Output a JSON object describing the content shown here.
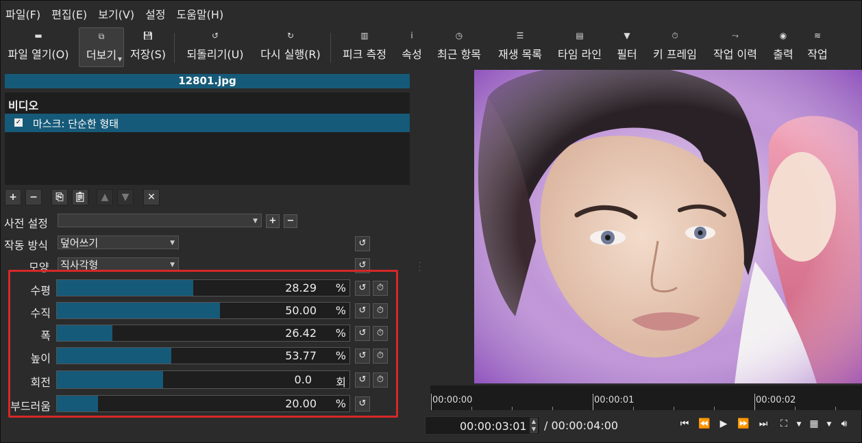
{
  "menu": [
    "파일(F)",
    "편집(E)",
    "보기(V)",
    "설정",
    "도움말(H)"
  ],
  "toolbar": {
    "open": "파일 열기(O)",
    "more": "더보기",
    "save": "저장(S)",
    "undo": "되돌리기(U)",
    "redo": "다시 실행(R)",
    "peak": "피크 측정",
    "properties": "속성",
    "recent": "최근 항목",
    "playlist": "재생 목록",
    "timeline": "타임 라인",
    "filters": "필터",
    "keyframes": "키 프레임",
    "history": "작업 이력",
    "export": "출력",
    "jobs": "작업"
  },
  "filters_panel": {
    "filename": "12801.jpg",
    "section": "비디오",
    "items": [
      {
        "label": "마스크: 단순한 형태",
        "checked": true
      }
    ],
    "preset_label": "사전 설정",
    "preset_value": "",
    "operation_label": "작동 방식",
    "operation_value": "덮어쓰기",
    "shape_label": "모양",
    "shape_value": "직사각형",
    "params": [
      {
        "label": "수평",
        "value": "28.29",
        "unit": "%",
        "fill": 0.4658,
        "keyframe": true
      },
      {
        "label": "수직",
        "value": "50.00",
        "unit": "%",
        "fill": 0.5572,
        "keyframe": true
      },
      {
        "label": "폭",
        "value": "26.42",
        "unit": "%",
        "fill": 0.1888,
        "keyframe": true
      },
      {
        "label": "높이",
        "value": "53.77",
        "unit": "%",
        "fill": 0.3908,
        "keyframe": true
      },
      {
        "label": "회전",
        "value": "0.0",
        "unit": "회",
        "fill": 0.3628,
        "keyframe": true
      },
      {
        "label": "부드러움",
        "value": "20.00",
        "unit": "%",
        "fill": 0.1398,
        "keyframe": false
      }
    ]
  },
  "timeline": {
    "marks": [
      "00:00:00",
      "00:00:01",
      "00:00:02"
    ],
    "current_time": "00:00:03:01",
    "duration": "/ 00:00:04:00"
  },
  "colors": {
    "accent": "#165a79",
    "highlight_box": "#d62828",
    "background": "#2b2b2b"
  }
}
